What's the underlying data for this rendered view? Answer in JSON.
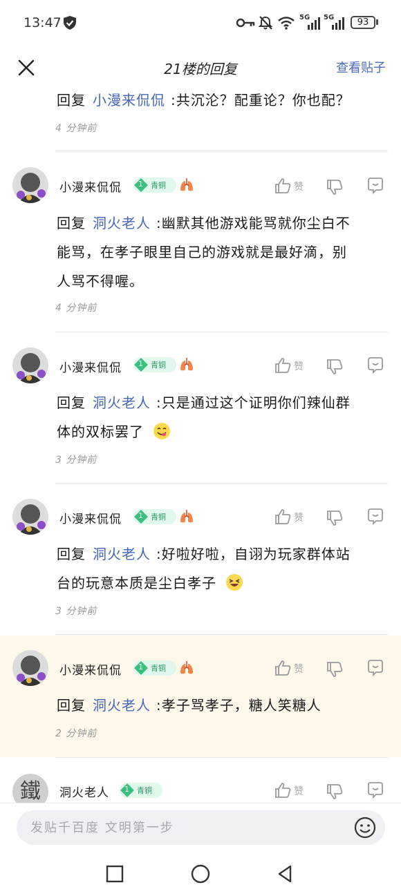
{
  "status_bar": {
    "time": "13:47",
    "battery": "93",
    "net1": "5G",
    "net2": "5G"
  },
  "header": {
    "title": "21楼的回复",
    "view_post": "查看贴子"
  },
  "reply_prefix": "回复",
  "first_item": {
    "mention": "小漫来侃侃",
    "text": ":共沉沦？配重论？你也配？",
    "time": "4 分钟前"
  },
  "replies": [
    {
      "username": "小漫来侃侃",
      "level": "1",
      "level_title": "青铜",
      "mention": "洞火老人",
      "lines": [
        ":幽默其他游戏能骂就你尘白不",
        "能骂，在孝子眼里自己的游戏就是最好滴，别",
        "人骂不得喔。"
      ],
      "time": "4 分钟前",
      "like_label": "赞"
    },
    {
      "username": "小漫来侃侃",
      "level": "1",
      "level_title": "青铜",
      "mention": "洞火老人",
      "lines": [
        ":只是通过这个证明你们辣仙群",
        "体的双标罢了"
      ],
      "time": "3 分钟前",
      "like_label": "赞"
    },
    {
      "username": "小漫来侃侃",
      "level": "1",
      "level_title": "青铜",
      "mention": "洞火老人",
      "lines": [
        ":好啦好啦，自诩为玩家群体站",
        "台的玩意本质是尘白孝子"
      ],
      "time": "3 分钟前",
      "like_label": "赞"
    },
    {
      "username": "小漫来侃侃",
      "level": "1",
      "level_title": "青铜",
      "mention": "洞火老人",
      "lines": [
        ":孝子骂孝子，糖人笑糖人"
      ],
      "time": "2 分钟前",
      "like_label": "赞"
    },
    {
      "username": "洞火老人",
      "level": "1",
      "level_title": "青铜",
      "like_label": "赞",
      "avatar_char": "鐵"
    }
  ],
  "input": {
    "placeholder": "发贴千百度 文明第一步"
  },
  "colors": {
    "accent": "#4566b8",
    "level_green": "#2b9a66",
    "highlight_bg": "#fdf8ea"
  }
}
